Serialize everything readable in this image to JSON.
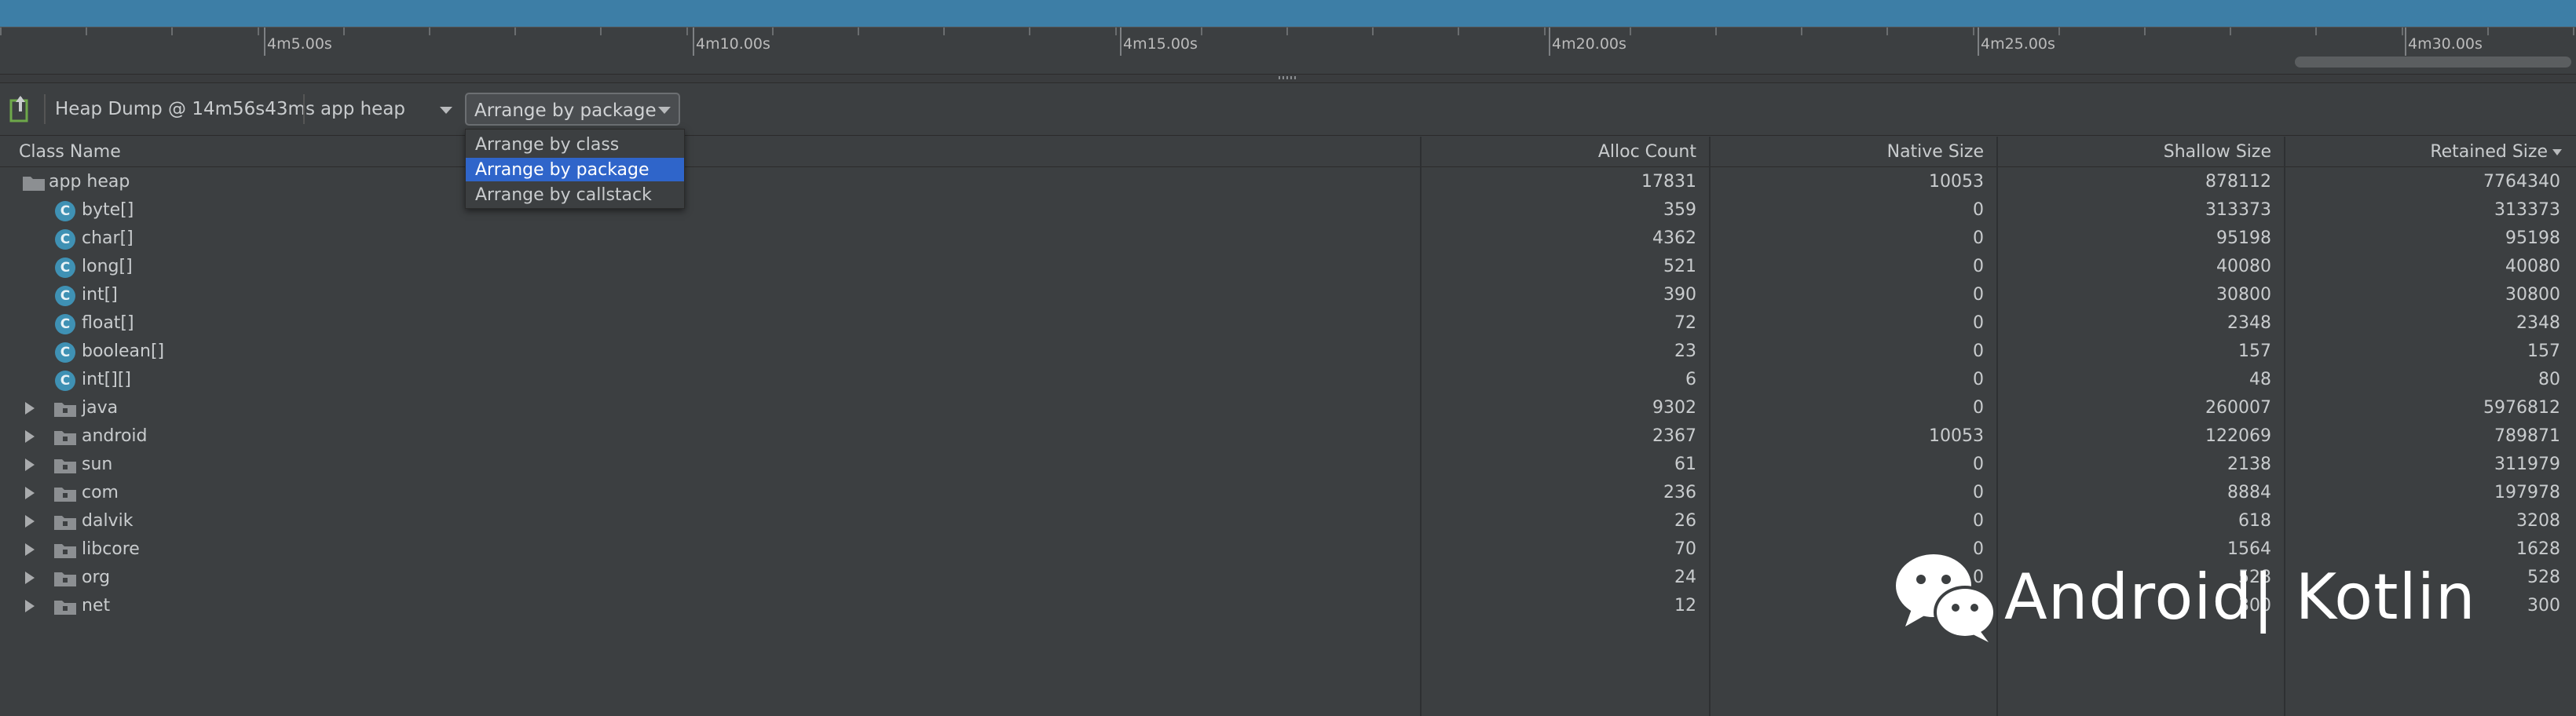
{
  "timeline": {
    "labels": [
      "4m5.00s",
      "4m10.00s",
      "4m15.00s",
      "4m20.00s",
      "4m25.00s",
      "4m30.00s"
    ]
  },
  "toolbar": {
    "heap_dump_label": "Heap Dump @ 14m56s43ms",
    "heap_select_value": "app heap",
    "arrange_select_value": "Arrange by package"
  },
  "dropdown": {
    "options": [
      "Arrange by class",
      "Arrange by package",
      "Arrange by callstack"
    ],
    "selected": "Arrange by package"
  },
  "table": {
    "columns": {
      "class_name": "Class Name",
      "alloc_count": "Alloc Count",
      "native_size": "Native Size",
      "shallow_size": "Shallow Size",
      "retained_size": "Retained Size"
    },
    "sort_column": "Retained Size",
    "rows": [
      {
        "name": "app heap",
        "type": "root-folder",
        "alloc": "17831",
        "native": "10053",
        "shallow": "878112",
        "retained": "7764340"
      },
      {
        "name": "byte[]",
        "type": "class",
        "alloc": "359",
        "native": "0",
        "shallow": "313373",
        "retained": "313373"
      },
      {
        "name": "char[]",
        "type": "class",
        "alloc": "4362",
        "native": "0",
        "shallow": "95198",
        "retained": "95198"
      },
      {
        "name": "long[]",
        "type": "class",
        "alloc": "521",
        "native": "0",
        "shallow": "40080",
        "retained": "40080"
      },
      {
        "name": "int[]",
        "type": "class",
        "alloc": "390",
        "native": "0",
        "shallow": "30800",
        "retained": "30800"
      },
      {
        "name": "float[]",
        "type": "class",
        "alloc": "72",
        "native": "0",
        "shallow": "2348",
        "retained": "2348"
      },
      {
        "name": "boolean[]",
        "type": "class",
        "alloc": "23",
        "native": "0",
        "shallow": "157",
        "retained": "157"
      },
      {
        "name": "int[][]",
        "type": "class",
        "alloc": "6",
        "native": "0",
        "shallow": "48",
        "retained": "80"
      },
      {
        "name": "java",
        "type": "package",
        "alloc": "9302",
        "native": "0",
        "shallow": "260007",
        "retained": "5976812"
      },
      {
        "name": "android",
        "type": "package",
        "alloc": "2367",
        "native": "10053",
        "shallow": "122069",
        "retained": "789871"
      },
      {
        "name": "sun",
        "type": "package",
        "alloc": "61",
        "native": "0",
        "shallow": "2138",
        "retained": "311979"
      },
      {
        "name": "com",
        "type": "package",
        "alloc": "236",
        "native": "0",
        "shallow": "8884",
        "retained": "197978"
      },
      {
        "name": "dalvik",
        "type": "package",
        "alloc": "26",
        "native": "0",
        "shallow": "618",
        "retained": "3208"
      },
      {
        "name": "libcore",
        "type": "package",
        "alloc": "70",
        "native": "0",
        "shallow": "1564",
        "retained": "1628"
      },
      {
        "name": "org",
        "type": "package",
        "alloc": "24",
        "native": "0",
        "shallow": "528",
        "retained": "528"
      },
      {
        "name": "net",
        "type": "package",
        "alloc": "12",
        "native": "0",
        "shallow": "300",
        "retained": "300"
      }
    ]
  },
  "watermark": {
    "text": "Android| Kotlin",
    "icon": "wechat-icon"
  },
  "colors": {
    "timeline_bar": "#3d7ea6",
    "background": "#3c3f41",
    "selection": "#2f65ca",
    "class_icon": "#3f91b4"
  }
}
